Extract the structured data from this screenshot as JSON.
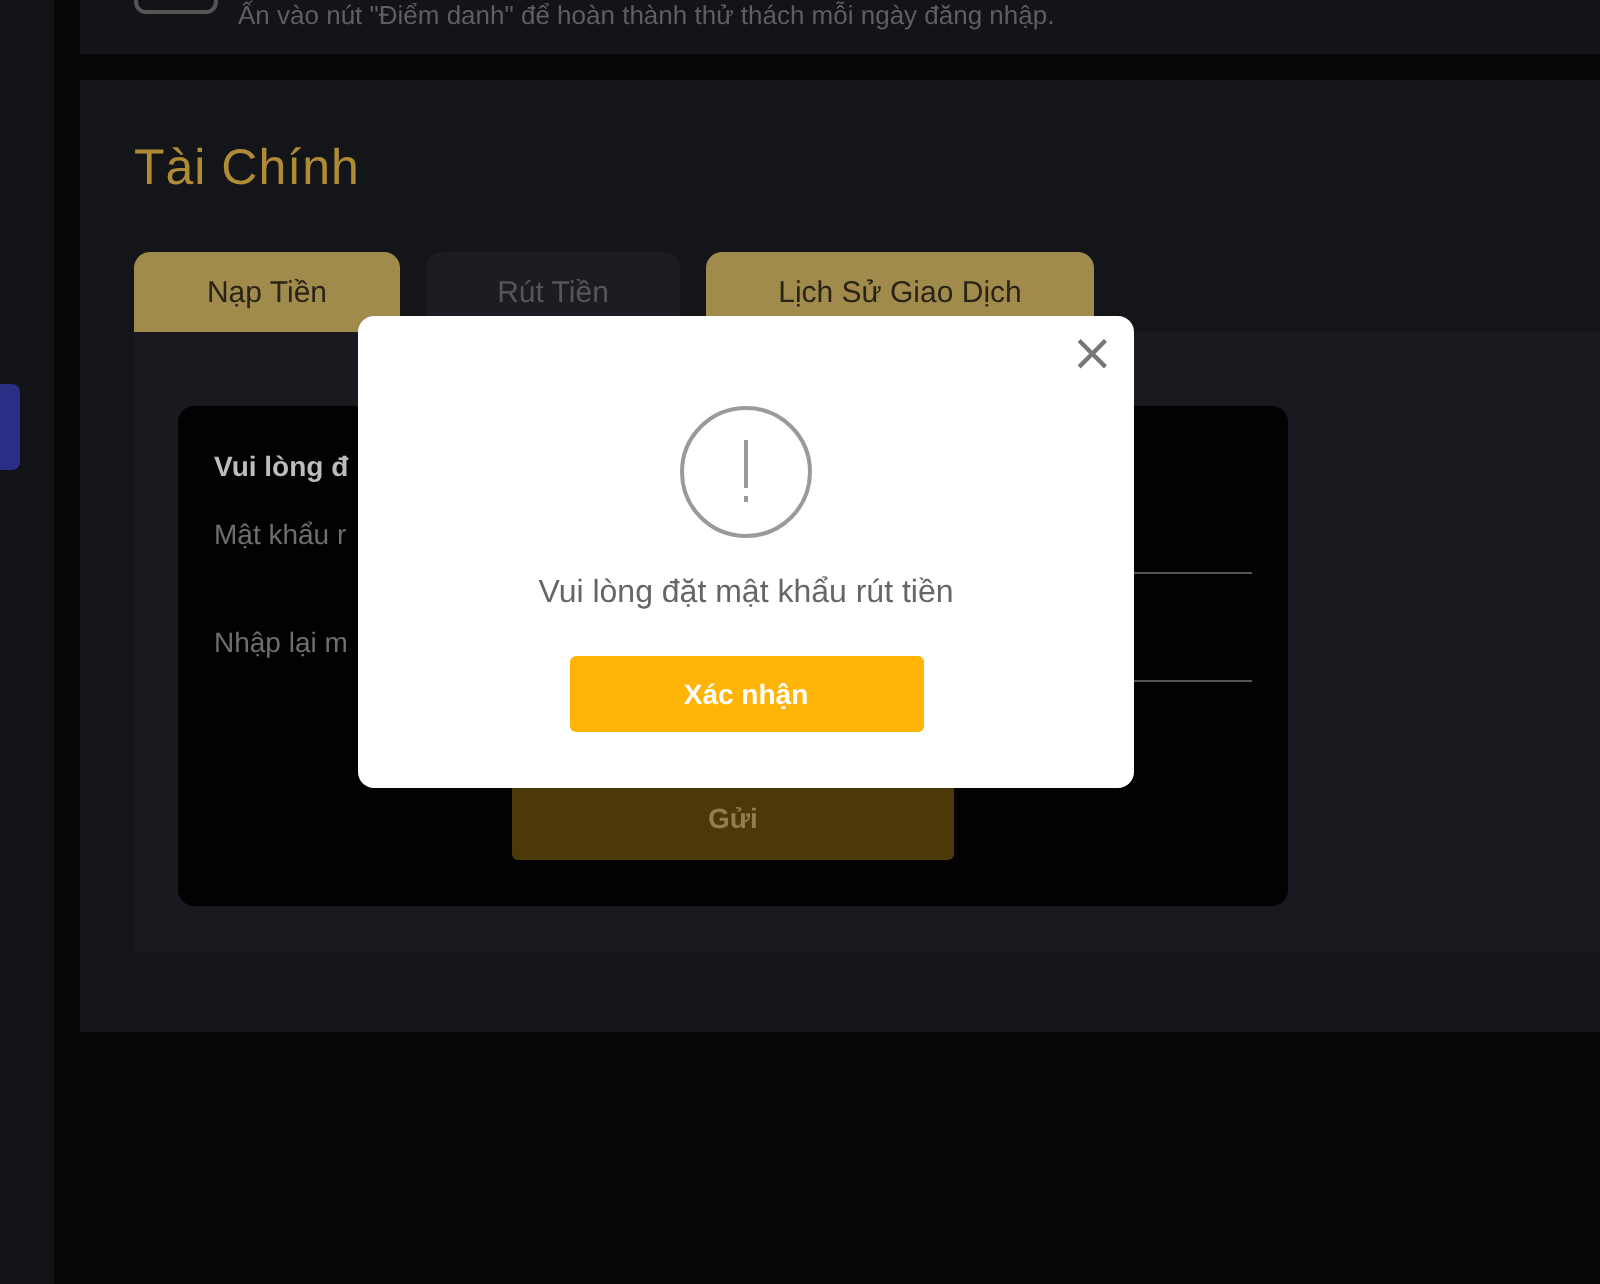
{
  "notice": {
    "text": "Ấn vào nút \"Điểm danh\" để hoàn thành thử thách mỗi ngày đăng nhập."
  },
  "section": {
    "title": "Tài Chính"
  },
  "tabs": [
    {
      "label": "Nạp Tiền",
      "highlighted": true
    },
    {
      "label": "Rút Tiền",
      "highlighted": false
    },
    {
      "label": "Lịch Sử Giao Dịch",
      "highlighted": true
    }
  ],
  "form": {
    "heading": "Vui lòng đ",
    "fields": [
      {
        "label": "Mật khẩu r"
      },
      {
        "label": "Nhập lại m"
      }
    ],
    "submit": "Gửi"
  },
  "dialog": {
    "message": "Vui lòng đặt mật khẩu rút tiền",
    "confirm": "Xác nhận",
    "close": "×"
  }
}
